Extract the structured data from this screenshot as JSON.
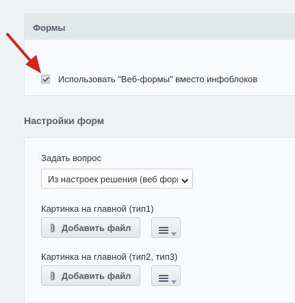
{
  "forms_section": {
    "title": "Формы",
    "checkbox_label": "Использовать \"Веб-формы\" вместо инфоблоков",
    "checkbox_checked": true
  },
  "settings_section": {
    "title": "Настройки форм",
    "ask_question": {
      "label": "Задать вопрос",
      "selected": "Из настроек решения (веб формы)"
    },
    "image_main_type1": {
      "label": "Картинка на главной (тип1)",
      "add_file_label": "Добавить файл"
    },
    "image_main_type2_3": {
      "label": "Картинка на главной (тип2, тип3)",
      "add_file_label": "Добавить файл"
    }
  },
  "colors": {
    "annotation_arrow": "#d0261f",
    "panel_header": "#e0e8ea",
    "background": "#eef2f4"
  }
}
